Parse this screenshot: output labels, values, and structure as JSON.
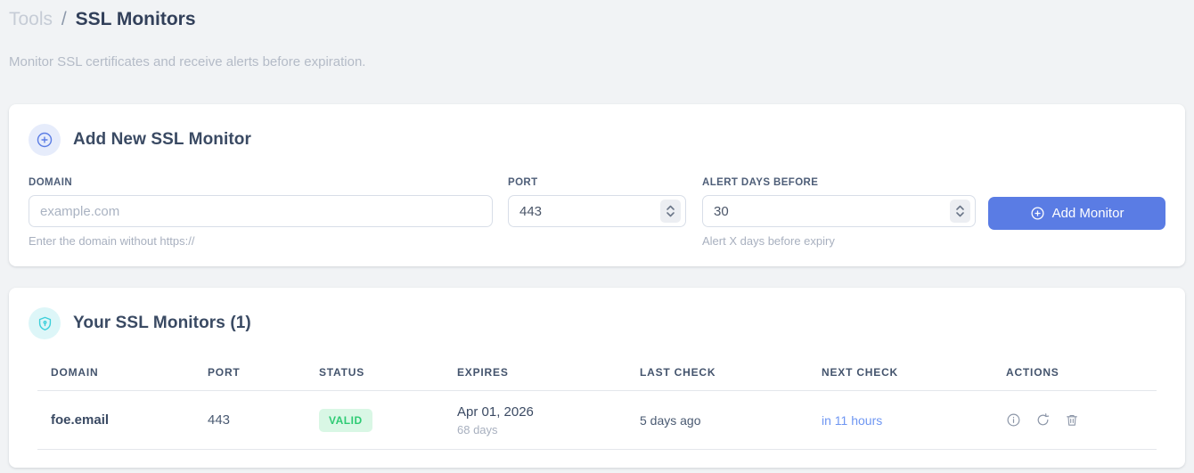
{
  "breadcrumb": {
    "parent": "Tools",
    "separator": "/",
    "current": "SSL Monitors"
  },
  "subtitle": "Monitor SSL certificates and receive alerts before expiration.",
  "add_card": {
    "title": "Add New SSL Monitor",
    "icon": "plus-circle-icon",
    "domain_field": {
      "label": "DOMAIN",
      "placeholder": "example.com",
      "value": "",
      "help": "Enter the domain without https://"
    },
    "port_field": {
      "label": "PORT",
      "value": "443"
    },
    "alert_field": {
      "label": "ALERT DAYS BEFORE",
      "value": "30",
      "help": "Alert X days before expiry"
    },
    "submit_label": "Add Monitor"
  },
  "monitors_card": {
    "title": "Your SSL Monitors (1)",
    "icon": "shield-icon",
    "headers": [
      "DOMAIN",
      "PORT",
      "STATUS",
      "EXPIRES",
      "LAST CHECK",
      "NEXT CHECK",
      "ACTIONS"
    ],
    "rows": [
      {
        "domain": "foe.email",
        "port": "443",
        "status": "VALID",
        "expires_date": "Apr 01, 2026",
        "expires_remaining": "68 days",
        "last_check": "5 days ago",
        "next_check": "in 11 hours",
        "action_icons": [
          "info-icon",
          "refresh-icon",
          "trash-icon"
        ]
      }
    ]
  },
  "colors": {
    "accent_blue": "#5a7ce4",
    "next_check_blue": "#6e96f2",
    "valid_badge_bg": "#d9f7e5",
    "valid_badge_text": "#2ecb74",
    "icon_badge_blue_bg": "#e6ecfb",
    "icon_badge_cyan_bg": "#ddf6f8",
    "icon_cyan": "#3bcfda",
    "page_bg": "#f1f3f5"
  }
}
